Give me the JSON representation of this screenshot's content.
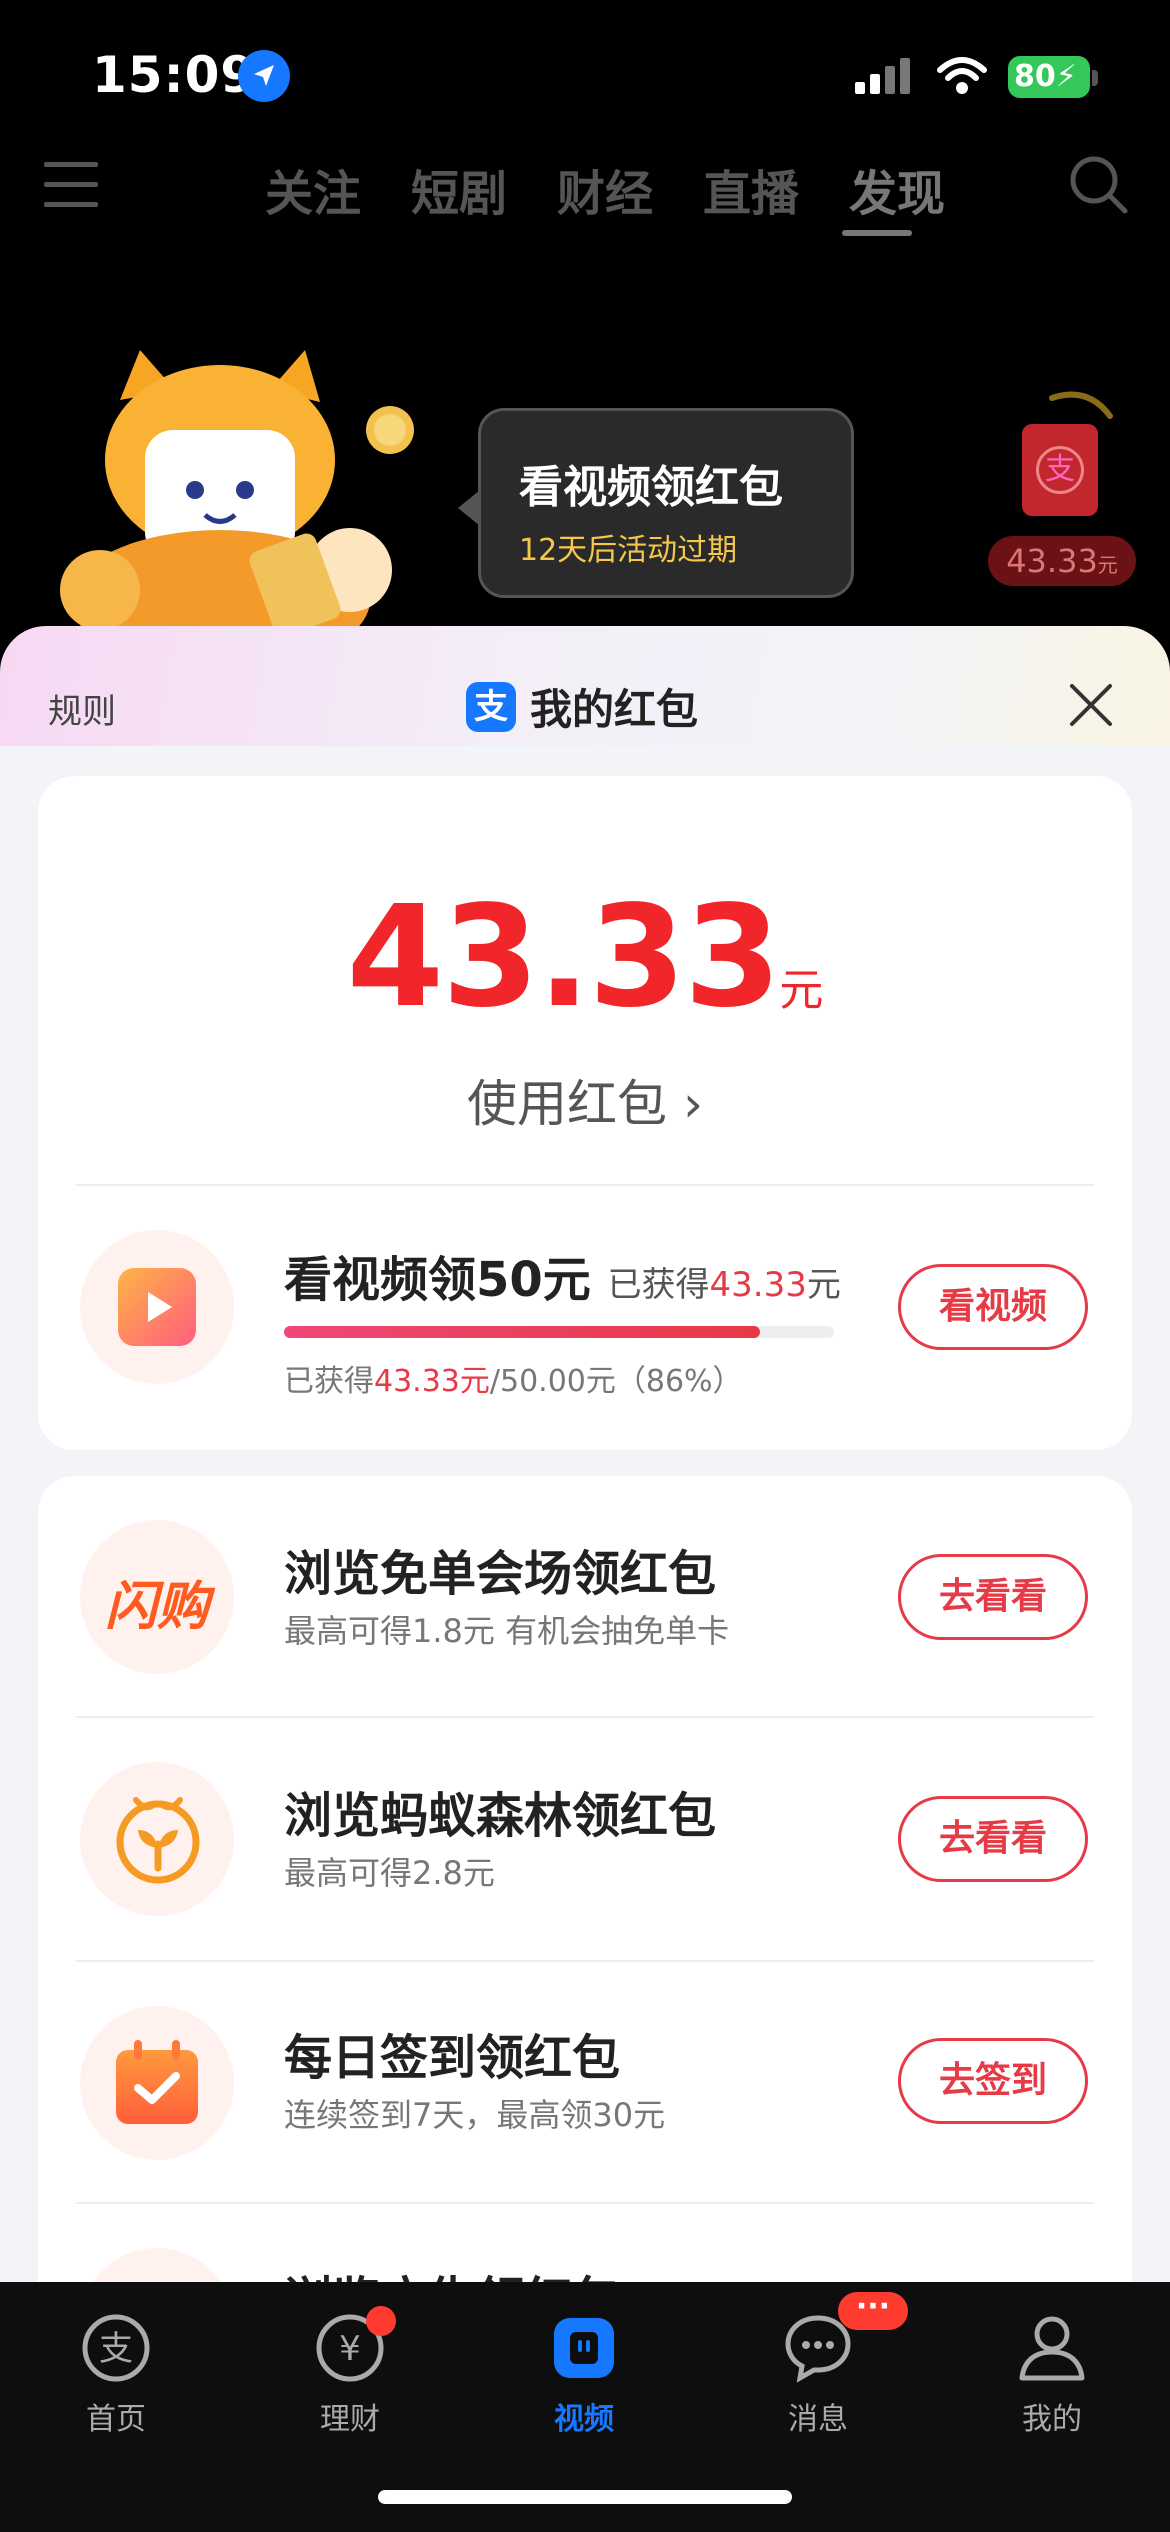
{
  "status": {
    "time": "15:09",
    "battery": "80"
  },
  "topnav": {
    "tabs": [
      "关注",
      "短剧",
      "财经",
      "直播",
      "发现"
    ],
    "active_tab": "发现"
  },
  "banner": {
    "bubble_title": "看视频领红包",
    "bubble_sub": "12天后活动过期",
    "envelope_symbol": "支",
    "envelope_amount": "43.33",
    "envelope_unit": "元"
  },
  "sheet": {
    "rules": "规则",
    "logo": "支",
    "title": "我的红包",
    "amount": "43.33",
    "amount_unit": "元",
    "use_label": "使用红包",
    "use_chevron": "›",
    "video_task": {
      "title": "看视频领50元",
      "earned_label": "已获得",
      "earned_value": "43.33",
      "earned_unit": "元",
      "detail_prefix": "已获得",
      "detail_value": "43.33元",
      "detail_suffix": "/50.00元（86%）",
      "progress": 0.866,
      "button": "看视频"
    },
    "tasks": [
      {
        "title": "浏览免单会场领红包",
        "sub": "最高可得1.8元 有机会抽免单卡",
        "button": "去看看",
        "icon": "flash-buy-icon",
        "icon_text": "闪购"
      },
      {
        "title": "浏览蚂蚁森林领红包",
        "sub": "最高可得2.8元",
        "button": "去看看",
        "icon": "ant-forest-icon"
      },
      {
        "title": "每日签到领红包",
        "sub": "连续签到7天，最高领30元",
        "button": "去签到",
        "icon": "calendar-check-icon"
      },
      {
        "title": "浏览广告领红包",
        "sub": "",
        "button": "",
        "icon": "ad-icon"
      }
    ]
  },
  "tabbar": {
    "items": [
      "首页",
      "理财",
      "视频",
      "消息",
      "我的"
    ],
    "active": "视频",
    "message_badge": "···"
  },
  "colors": {
    "accent_red": "#e63a46",
    "alipay_blue": "#1677ff",
    "amount_red": "#f0262b"
  }
}
